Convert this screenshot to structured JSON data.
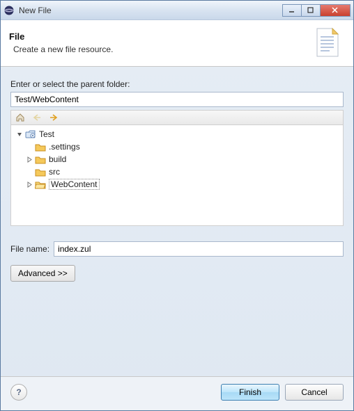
{
  "window": {
    "title": "New File"
  },
  "banner": {
    "title": "File",
    "subtitle": "Create a new file resource."
  },
  "parentFolder": {
    "label": "Enter or select the parent folder:",
    "value": "Test/WebContent"
  },
  "tree": {
    "root": {
      "name": "Test"
    },
    "children": [
      {
        "name": ".settings"
      },
      {
        "name": "build"
      },
      {
        "name": "src"
      },
      {
        "name": "WebContent",
        "selected": true
      }
    ]
  },
  "fileName": {
    "label": "File name:",
    "value": "index.zul"
  },
  "buttons": {
    "advanced": "Advanced >>",
    "finish": "Finish",
    "cancel": "Cancel"
  }
}
